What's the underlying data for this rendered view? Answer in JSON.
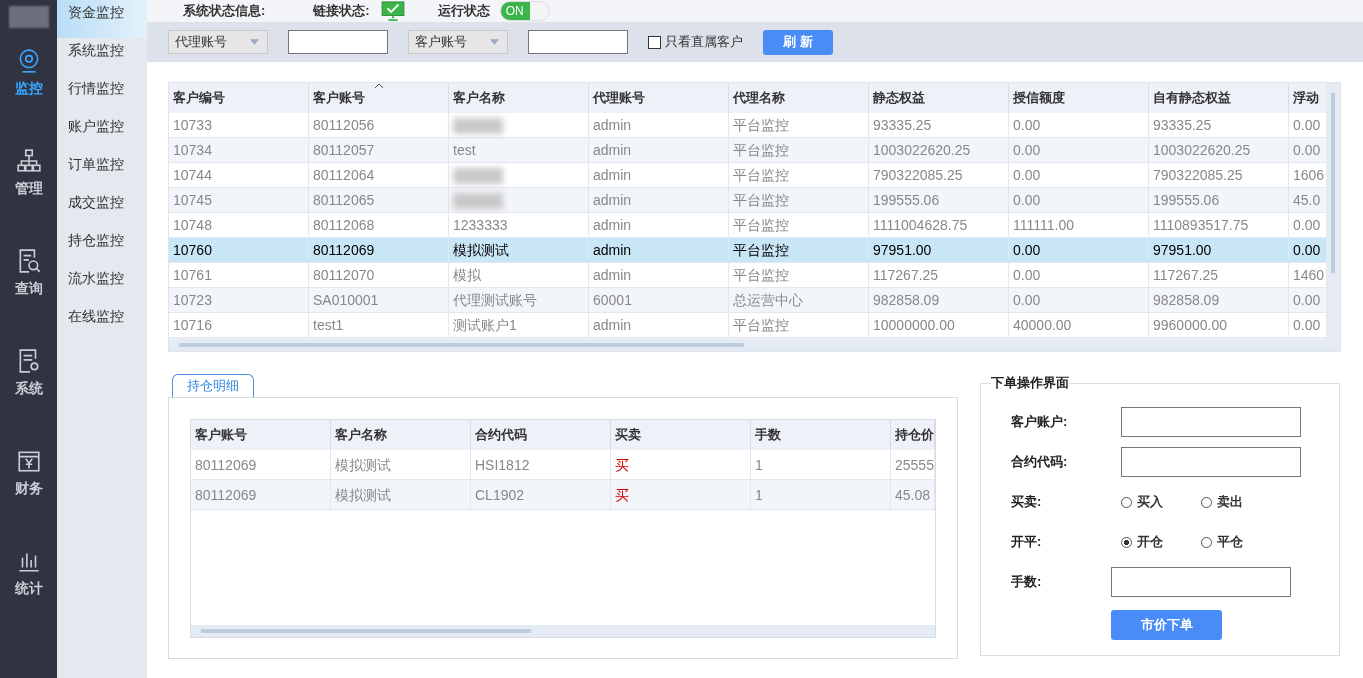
{
  "nav": {
    "items": [
      {
        "label": "监控",
        "selected": true
      },
      {
        "label": "管理",
        "selected": false
      },
      {
        "label": "查询",
        "selected": false
      },
      {
        "label": "系统",
        "selected": false
      },
      {
        "label": "财务",
        "selected": false
      },
      {
        "label": "统计",
        "selected": false
      }
    ]
  },
  "menu": {
    "items": [
      {
        "label": "资金监控",
        "selected": true
      },
      {
        "label": "系统监控",
        "selected": false
      },
      {
        "label": "行情监控",
        "selected": false
      },
      {
        "label": "账户监控",
        "selected": false
      },
      {
        "label": "订单监控",
        "selected": false
      },
      {
        "label": "成交监控",
        "selected": false
      },
      {
        "label": "持仓监控",
        "selected": false
      },
      {
        "label": "流水监控",
        "selected": false
      },
      {
        "label": "在线监控",
        "selected": false
      }
    ]
  },
  "status_bar": {
    "title": "系统状态信息:",
    "link_label": "链接状态:",
    "run_label": "运行状态",
    "run_toggle": {
      "label": "ON",
      "on": true
    }
  },
  "filters": {
    "agent_select": "代理账号",
    "customer_select": "客户账号",
    "direct_only": {
      "label": "只看直属客户",
      "checked": false
    },
    "refresh": "刷 新"
  },
  "table": {
    "columns": [
      {
        "label": "客户编号",
        "sorted": false
      },
      {
        "label": "客户账号",
        "sorted": true
      },
      {
        "label": "客户名称",
        "sorted": false
      },
      {
        "label": "代理账号",
        "sorted": false
      },
      {
        "label": "代理名称",
        "sorted": false
      },
      {
        "label": "静态权益",
        "sorted": false
      },
      {
        "label": "授信额度",
        "sorted": false
      },
      {
        "label": "自有静态权益",
        "sorted": false
      },
      {
        "label": "浮动",
        "sorted": false
      }
    ],
    "rows": [
      {
        "selected": false,
        "redacted": true,
        "cells": [
          "10733",
          "80112056",
          "",
          "admin",
          "平台监控",
          "93335.25",
          "0.00",
          "93335.25",
          "0.00"
        ]
      },
      {
        "selected": false,
        "redacted": false,
        "cells": [
          "10734",
          "80112057",
          "test",
          "admin",
          "平台监控",
          "1003022620.25",
          "0.00",
          "1003022620.25",
          "0.00"
        ]
      },
      {
        "selected": false,
        "redacted": true,
        "cells": [
          "10744",
          "80112064",
          "",
          "admin",
          "平台监控",
          "790322085.25",
          "0.00",
          "790322085.25",
          "1606"
        ]
      },
      {
        "selected": false,
        "redacted": true,
        "cells": [
          "10745",
          "80112065",
          "",
          "admin",
          "平台监控",
          "199555.06",
          "0.00",
          "199555.06",
          "45.0"
        ]
      },
      {
        "selected": false,
        "redacted": false,
        "cells": [
          "10748",
          "80112068",
          "1233333",
          "admin",
          "平台监控",
          "1111004628.75",
          "111111.00",
          "1110893517.75",
          "0.00"
        ]
      },
      {
        "selected": true,
        "redacted": false,
        "cells": [
          "10760",
          "80112069",
          "模拟测试",
          "admin",
          "平台监控",
          "97951.00",
          "0.00",
          "97951.00",
          "0.00"
        ]
      },
      {
        "selected": false,
        "redacted": false,
        "cells": [
          "10761",
          "80112070",
          "模拟",
          "admin",
          "平台监控",
          "117267.25",
          "0.00",
          "117267.25",
          "1460"
        ]
      },
      {
        "selected": false,
        "redacted": false,
        "cells": [
          "10723",
          "SA010001",
          "代理测试账号",
          "60001",
          "总运营中心",
          "982858.09",
          "0.00",
          "982858.09",
          "0.00"
        ]
      },
      {
        "selected": false,
        "redacted": false,
        "cells": [
          "10716",
          "test1",
          "测试账户1",
          "admin",
          "平台监控",
          "10000000.00",
          "40000.00",
          "9960000.00",
          "0.00"
        ]
      }
    ]
  },
  "positions": {
    "tab": "持仓明细",
    "columns": [
      "客户账号",
      "客户名称",
      "合约代码",
      "买卖",
      "手数",
      "持仓价"
    ],
    "rows": [
      {
        "account": "80112069",
        "name": "模拟测试",
        "contract": "HSI1812",
        "side": {
          "text": "买",
          "color": "#d40000"
        },
        "lots": "1",
        "price": "25555"
      },
      {
        "account": "80112069",
        "name": "模拟测试",
        "contract": "CL1902",
        "side": {
          "text": "买",
          "color": "#d40000"
        },
        "lots": "1",
        "price": "45.08"
      }
    ]
  },
  "order_form": {
    "title": "下单操作界面",
    "rows": [
      {
        "kind": "input",
        "label": "客户账户:"
      },
      {
        "kind": "input",
        "label": "合约代码:"
      },
      {
        "kind": "radio",
        "label": "买卖:",
        "options": [
          {
            "label": "买入",
            "selected": false
          },
          {
            "label": "卖出",
            "selected": false
          }
        ]
      },
      {
        "kind": "radio",
        "label": "开平:",
        "options": [
          {
            "label": "开仓",
            "selected": true
          },
          {
            "label": "平仓",
            "selected": false
          }
        ]
      },
      {
        "kind": "input",
        "label": "手数:"
      }
    ],
    "submit": "市价下单"
  }
}
